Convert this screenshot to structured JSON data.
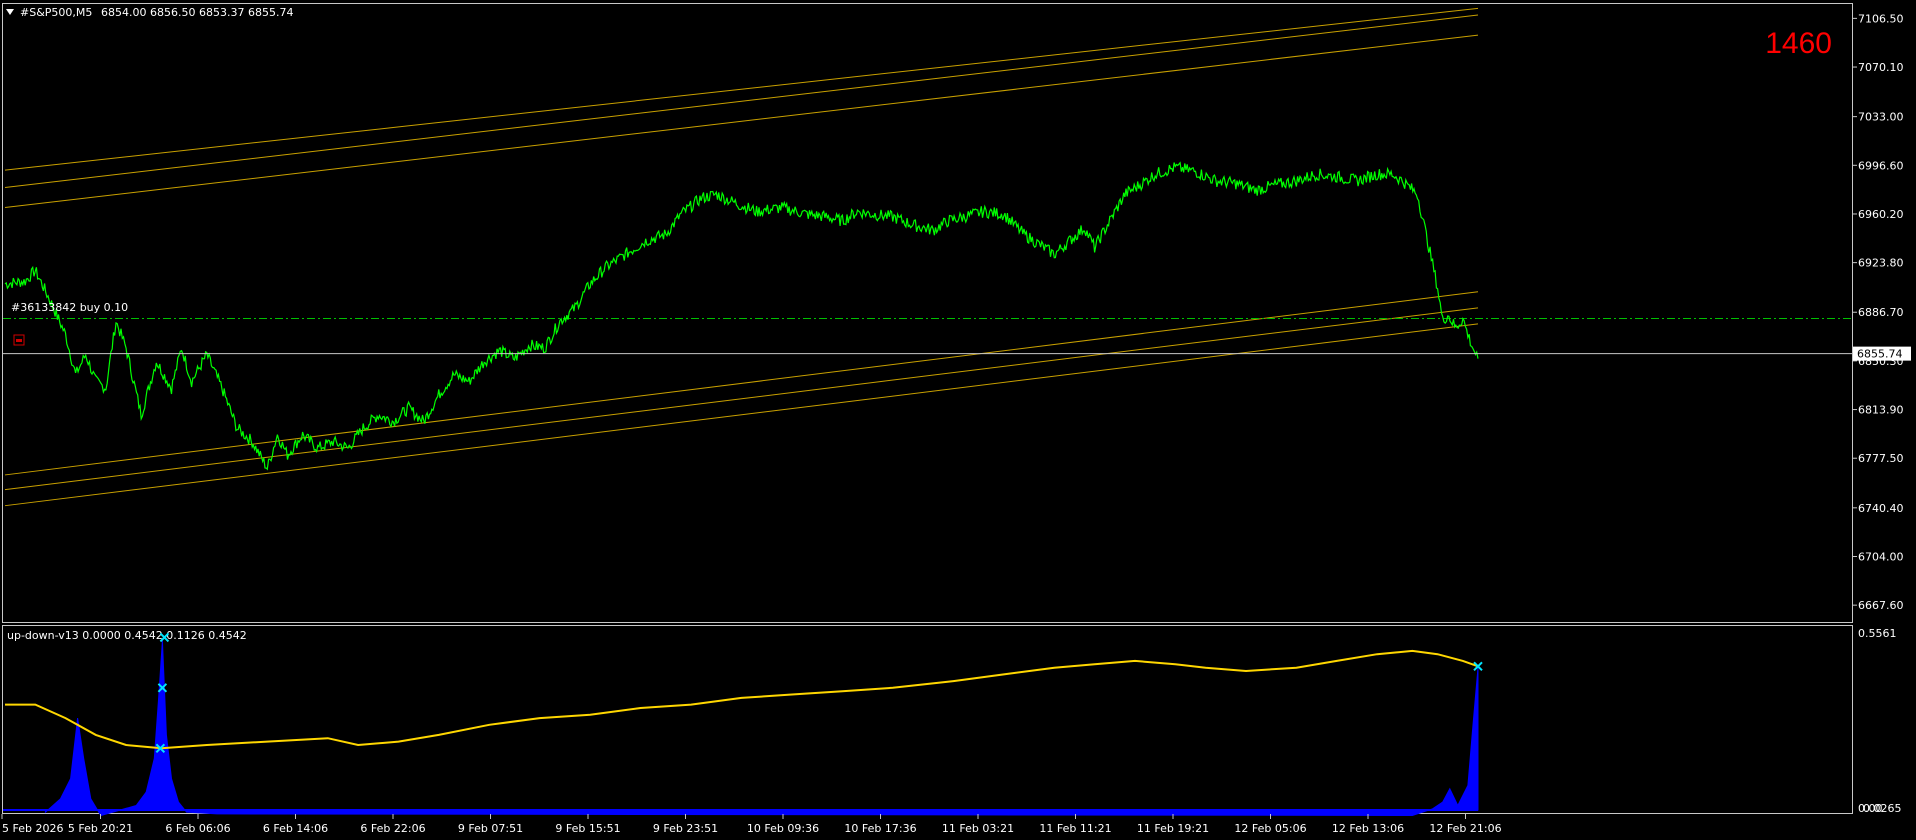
{
  "colors": {
    "background": "#000000",
    "frame": "#c8c8c8",
    "price_line": "#00ff00",
    "channel": "#c8a000",
    "order_line": "#00c000",
    "indicator_line": "#ffd700",
    "histogram": "#0000ff",
    "histogram_red": "#b00000",
    "marker": "#00e5ff",
    "counter": "#ff0000",
    "price_tag_bg": "#ffffff",
    "price_tag_text": "#000000"
  },
  "header": {
    "symbol_label": "#S&P500,M5",
    "ohlc": "6854.00 6856.50 6853.37 6855.74",
    "menu_icon": "triangle-down-icon"
  },
  "counter_label": "1460",
  "order_label": "#36133842 buy 0.10",
  "order_icon": "trade-stop-icon",
  "current_price_tag": "6855.74",
  "indicator": {
    "label": "up-down-v13 0.0000 0.4542 0.1126 0.4542",
    "scale_top": "0.5561",
    "scale_bottom": "0.0265",
    "scale_bottom_overlay": "0.00"
  },
  "chart_data": [
    {
      "type": "line",
      "title": "#S&P500,M5",
      "y_ticks": [
        "7106.50",
        "7070.10",
        "7033.00",
        "6996.60",
        "6960.20",
        "6923.80",
        "6886.70",
        "6850.30",
        "6813.90",
        "6777.50",
        "6740.40",
        "6704.00",
        "6667.60"
      ],
      "x_ticks": [
        "5 Feb 2026",
        "5 Feb 20:21",
        "6 Feb 06:06",
        "6 Feb 14:06",
        "6 Feb 22:06",
        "9 Feb 07:51",
        "9 Feb 15:51",
        "9 Feb 23:51",
        "10 Feb 09:36",
        "10 Feb 17:36",
        "11 Feb 03:21",
        "11 Feb 11:21",
        "11 Feb 19:21",
        "12 Feb 05:06",
        "12 Feb 13:06",
        "12 Feb 21:06"
      ],
      "ylim": [
        6655,
        7118
      ],
      "x_range": [
        0,
        1460
      ],
      "series": [
        {
          "values": [
            [
              0,
              6908
            ],
            [
              20,
              6910
            ],
            [
              30,
              6918
            ],
            [
              45,
              6895
            ],
            [
              60,
              6870
            ],
            [
              70,
              6840
            ],
            [
              80,
              6855
            ],
            [
              90,
              6835
            ],
            [
              100,
              6830
            ],
            [
              110,
              6880
            ],
            [
              120,
              6860
            ],
            [
              135,
              6810
            ],
            [
              150,
              6850
            ],
            [
              165,
              6830
            ],
            [
              175,
              6860
            ],
            [
              185,
              6835
            ],
            [
              200,
              6855
            ],
            [
              215,
              6830
            ],
            [
              230,
              6800
            ],
            [
              245,
              6790
            ],
            [
              260,
              6770
            ],
            [
              270,
              6795
            ],
            [
              280,
              6780
            ],
            [
              295,
              6795
            ],
            [
              310,
              6785
            ],
            [
              325,
              6790
            ],
            [
              340,
              6785
            ],
            [
              355,
              6800
            ],
            [
              370,
              6810
            ],
            [
              385,
              6805
            ],
            [
              400,
              6815
            ],
            [
              415,
              6805
            ],
            [
              430,
              6825
            ],
            [
              445,
              6840
            ],
            [
              460,
              6835
            ],
            [
              475,
              6850
            ],
            [
              490,
              6858
            ],
            [
              505,
              6852
            ],
            [
              520,
              6862
            ],
            [
              535,
              6860
            ],
            [
              550,
              6880
            ],
            [
              565,
              6890
            ],
            [
              580,
              6908
            ],
            [
              595,
              6920
            ],
            [
              615,
              6930
            ],
            [
              635,
              6940
            ],
            [
              655,
              6945
            ],
            [
              670,
              6960
            ],
            [
              690,
              6972
            ],
            [
              705,
              6975
            ],
            [
              725,
              6968
            ],
            [
              745,
              6962
            ],
            [
              770,
              6965
            ],
            [
              795,
              6960
            ],
            [
              815,
              6958
            ],
            [
              830,
              6955
            ],
            [
              845,
              6962
            ],
            [
              860,
              6960
            ],
            [
              880,
              6958
            ],
            [
              900,
              6952
            ],
            [
              920,
              6948
            ],
            [
              935,
              6955
            ],
            [
              950,
              6958
            ],
            [
              970,
              6962
            ],
            [
              990,
              6960
            ],
            [
              1010,
              6945
            ],
            [
              1030,
              6935
            ],
            [
              1040,
              6930
            ],
            [
              1055,
              6940
            ],
            [
              1070,
              6950
            ],
            [
              1080,
              6935
            ],
            [
              1095,
              6955
            ],
            [
              1110,
              6975
            ],
            [
              1125,
              6982
            ],
            [
              1140,
              6990
            ],
            [
              1160,
              6995
            ],
            [
              1180,
              6992
            ],
            [
              1200,
              6985
            ],
            [
              1220,
              6983
            ],
            [
              1240,
              6978
            ],
            [
              1260,
              6982
            ],
            [
              1280,
              6985
            ],
            [
              1300,
              6990
            ],
            [
              1320,
              6988
            ],
            [
              1340,
              6985
            ],
            [
              1360,
              6990
            ],
            [
              1375,
              6990
            ],
            [
              1385,
              6985
            ],
            [
              1400,
              6975
            ],
            [
              1410,
              6940
            ],
            [
              1420,
              6905
            ],
            [
              1425,
              6880
            ],
            [
              1430,
              6885
            ],
            [
              1438,
              6875
            ],
            [
              1445,
              6882
            ],
            [
              1450,
              6870
            ],
            [
              1455,
              6860
            ],
            [
              1460,
              6852
            ]
          ]
        }
      ],
      "channel_upper": [
        [
          0,
          6993,
          1460,
          7114
        ],
        [
          0,
          6980,
          1460,
          7109
        ],
        [
          0,
          6965,
          1460,
          7094
        ]
      ],
      "channel_lower": [
        [
          0,
          6765,
          1460,
          6902
        ],
        [
          0,
          6754,
          1460,
          6890
        ],
        [
          0,
          6742,
          1460,
          6878
        ]
      ],
      "order_price": 6882,
      "current_price": 6855.74
    },
    {
      "type": "line",
      "title": "up-down-v13",
      "ylim": [
        0.0265,
        0.5561
      ],
      "series": [
        {
          "name": "indicator",
          "values": [
            [
              0,
              0.34
            ],
            [
              30,
              0.34
            ],
            [
              60,
              0.3
            ],
            [
              90,
              0.25
            ],
            [
              120,
              0.22
            ],
            [
              155,
              0.21
            ],
            [
              200,
              0.22
            ],
            [
              260,
              0.23
            ],
            [
              320,
              0.24
            ],
            [
              350,
              0.22
            ],
            [
              390,
              0.23
            ],
            [
              430,
              0.25
            ],
            [
              480,
              0.28
            ],
            [
              530,
              0.3
            ],
            [
              580,
              0.31
            ],
            [
              630,
              0.33
            ],
            [
              680,
              0.34
            ],
            [
              730,
              0.36
            ],
            [
              780,
              0.37
            ],
            [
              830,
              0.38
            ],
            [
              880,
              0.39
            ],
            [
              940,
              0.41
            ],
            [
              990,
              0.43
            ],
            [
              1040,
              0.45
            ],
            [
              1080,
              0.46
            ],
            [
              1120,
              0.47
            ],
            [
              1160,
              0.46
            ],
            [
              1190,
              0.45
            ],
            [
              1230,
              0.44
            ],
            [
              1280,
              0.45
            ],
            [
              1320,
              0.47
            ],
            [
              1360,
              0.49
            ],
            [
              1395,
              0.5
            ],
            [
              1420,
              0.49
            ],
            [
              1445,
              0.47
            ],
            [
              1460,
              0.454
            ]
          ]
        },
        {
          "name": "histogram",
          "values": [
            [
              40,
              0.02
            ],
            [
              55,
              0.06
            ],
            [
              65,
              0.12
            ],
            [
              72,
              0.3
            ],
            [
              78,
              0.18
            ],
            [
              85,
              0.06
            ],
            [
              95,
              0.01
            ],
            [
              130,
              0.04
            ],
            [
              140,
              0.08
            ],
            [
              148,
              0.18
            ],
            [
              152,
              0.35
            ],
            [
              156,
              0.53
            ],
            [
              160,
              0.25
            ],
            [
              165,
              0.12
            ],
            [
              172,
              0.05
            ],
            [
              180,
              0.02
            ],
            [
              210,
              0.015
            ],
            [
              1395,
              0.01
            ],
            [
              1405,
              0.02
            ],
            [
              1415,
              0.03
            ],
            [
              1425,
              0.05
            ],
            [
              1432,
              0.09
            ],
            [
              1440,
              0.04
            ],
            [
              1450,
              0.1
            ],
            [
              1455,
              0.28
            ],
            [
              1460,
              0.45
            ]
          ]
        }
      ],
      "markers": [
        [
          154,
          0.21
        ],
        [
          156,
          0.39
        ],
        [
          158,
          0.54
        ],
        [
          1460,
          0.454
        ]
      ]
    }
  ]
}
